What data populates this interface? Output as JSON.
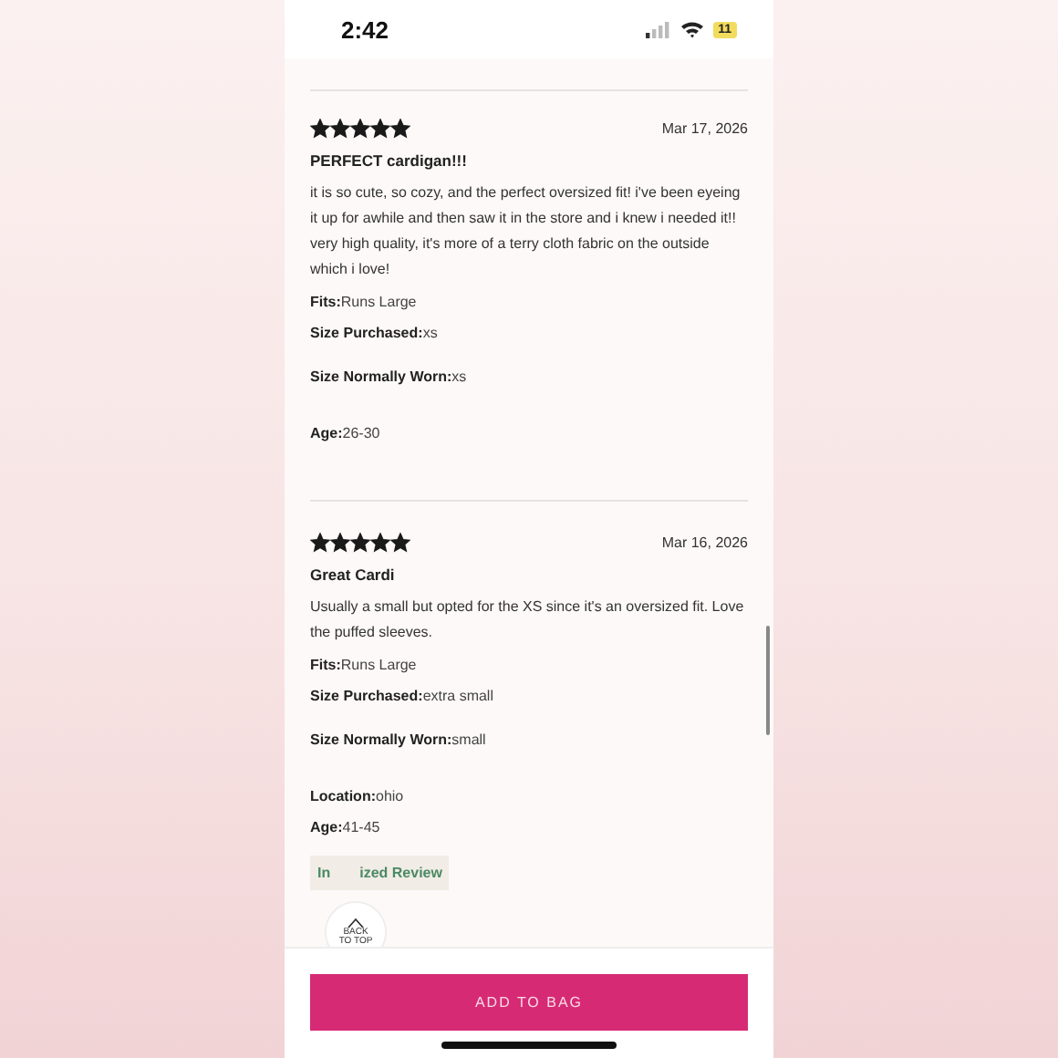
{
  "status_bar": {
    "time": "2:42",
    "battery": "11"
  },
  "reviews": [
    {
      "stars": 5,
      "date": "Mar 17, 2026",
      "title": "PERFECT cardigan!!!",
      "body": "it is so cute, so cozy, and the perfect oversized fit! i've been eyeing it up for awhile and then saw it in the store and i knew i needed it!! very high quality, it's more of a terry cloth fabric on the outside which i love!",
      "details": [
        {
          "label": "Fits:",
          "value": "Runs Large"
        },
        {
          "label": "Size Purchased:",
          "value": "xs"
        },
        {
          "label": "Size Normally Worn:",
          "value": "xs"
        },
        {
          "label": "Age:",
          "value": "26-30"
        }
      ]
    },
    {
      "stars": 5,
      "date": "Mar 16, 2026",
      "title": "Great Cardi",
      "body": "Usually a small but opted for the XS since it's an oversized fit. Love the puffed sleeves.",
      "details": [
        {
          "label": "Fits:",
          "value": "Runs Large"
        },
        {
          "label": "Size Purchased:",
          "value": "extra small"
        },
        {
          "label": "Size Normally Worn:",
          "value": "small"
        },
        {
          "label": "Location:",
          "value": "ohio"
        },
        {
          "label": "Age:",
          "value": "41-45"
        }
      ],
      "badge": [
        "In",
        "ized Review"
      ]
    }
  ],
  "back_to_top": [
    "BACK",
    "TO TOP"
  ],
  "add_to_bag": "ADD TO BAG"
}
